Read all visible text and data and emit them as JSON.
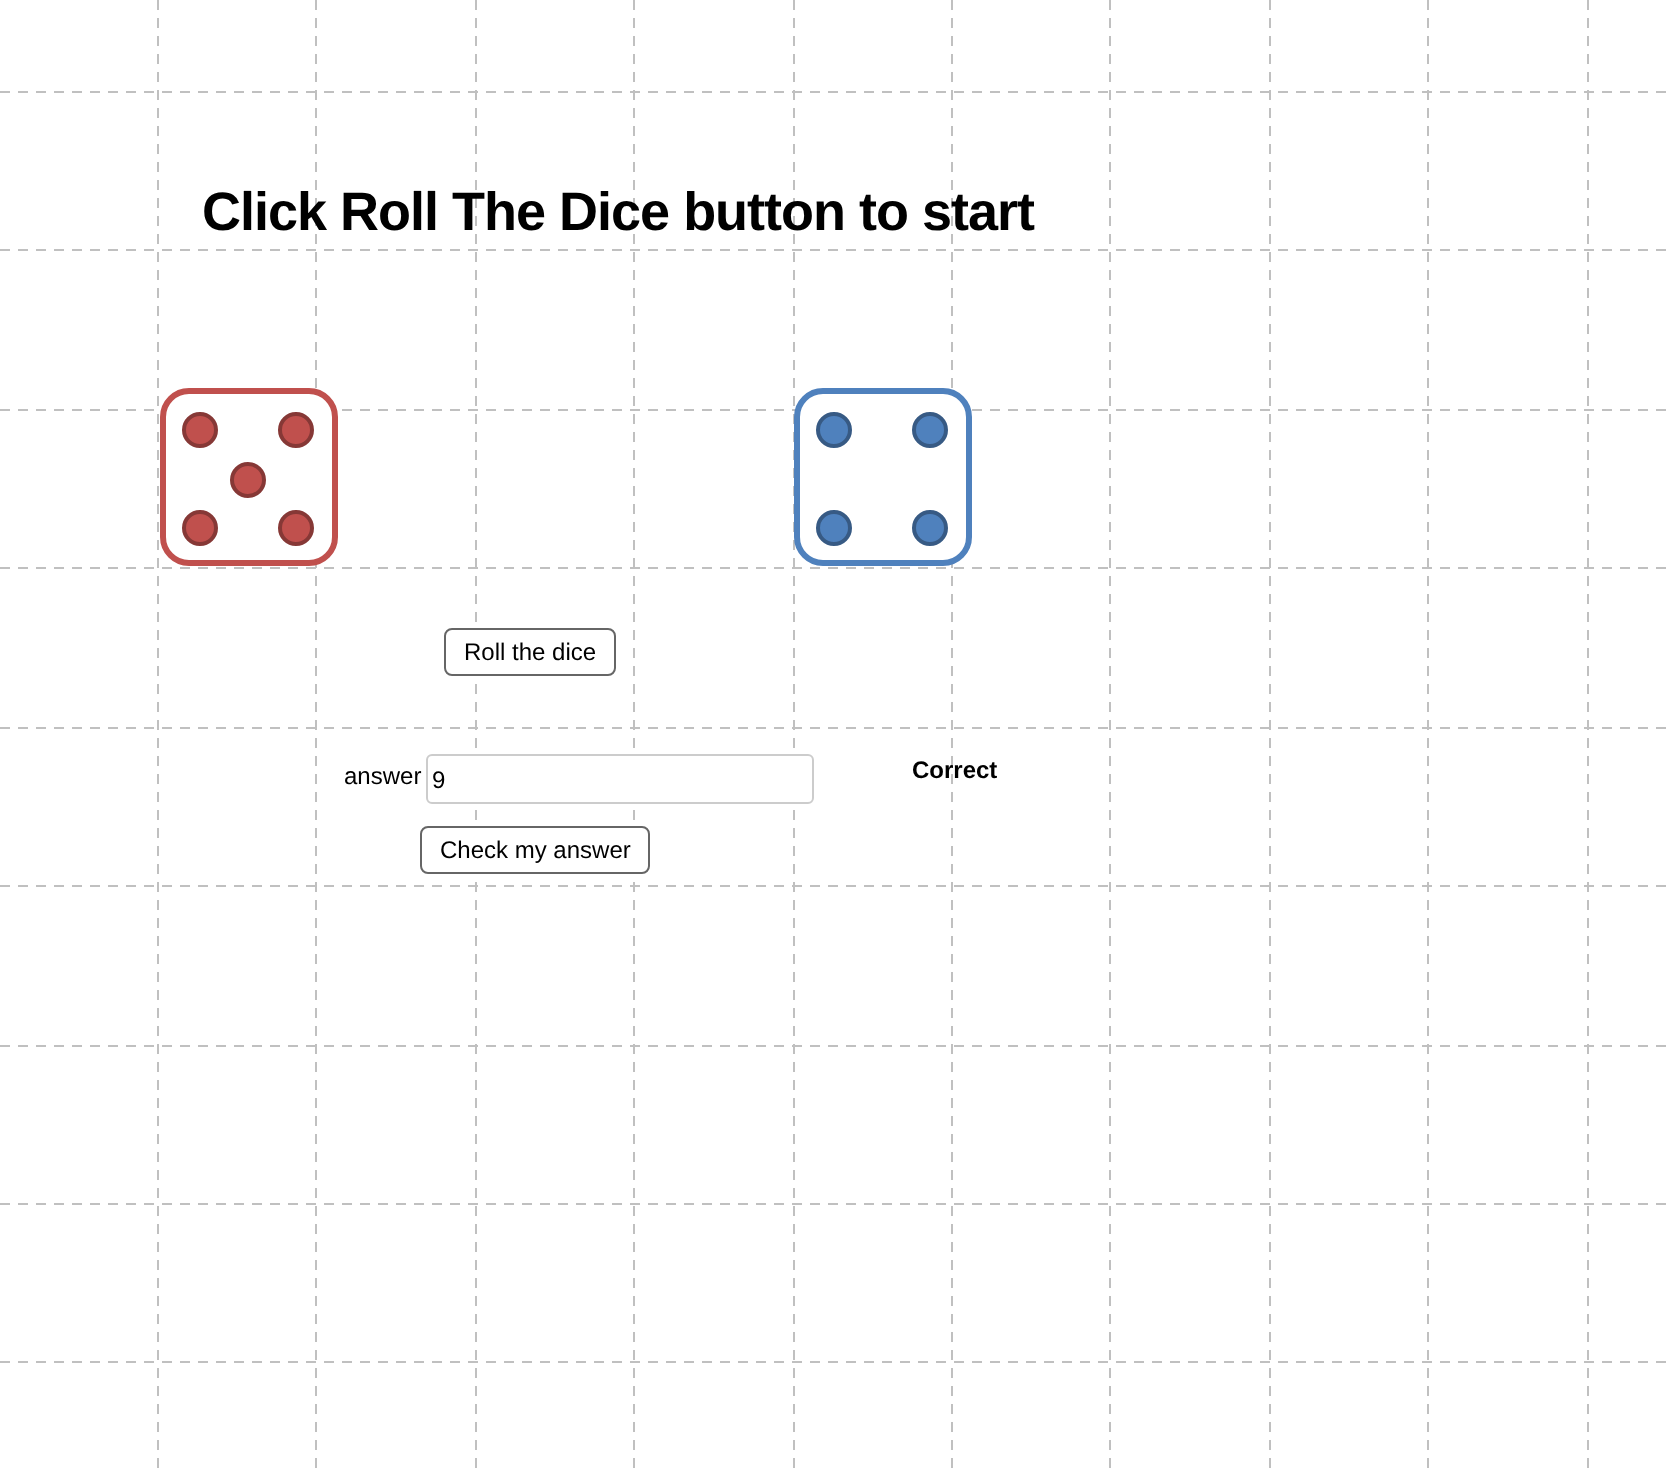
{
  "title": "Click Roll The Dice button to start",
  "dice": [
    {
      "kind": "five",
      "color": "#c0504d"
    },
    {
      "kind": "four",
      "color": "#4f81bd"
    }
  ],
  "roll_button": "Roll the dice",
  "answer": {
    "label": "answer",
    "value": "9"
  },
  "check_button": "Check my answer",
  "result": "Correct"
}
